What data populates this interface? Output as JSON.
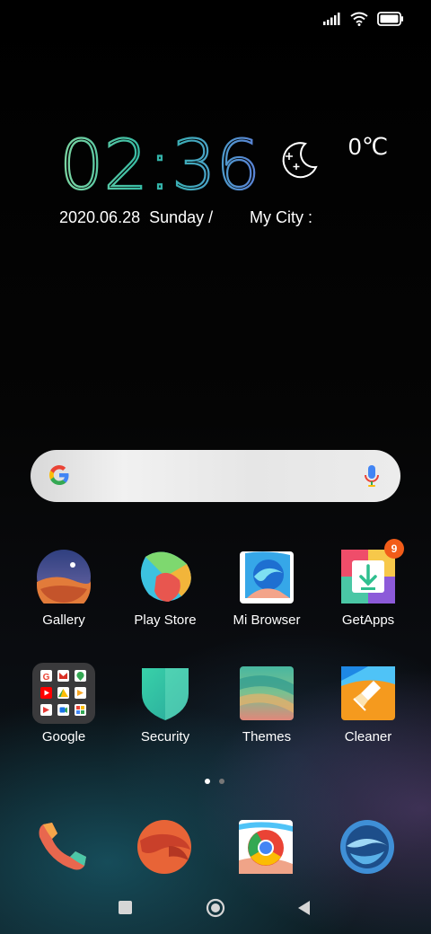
{
  "status_bar": {
    "signal_icon": "signal-icon",
    "wifi_icon": "wifi-icon",
    "battery_icon": "battery-icon"
  },
  "clock_widget": {
    "time": "02:36",
    "weather_icon": "moon-stars-icon",
    "temperature": "0℃",
    "date": "2020.06.28",
    "weekday": "Sunday /",
    "city": "My City :"
  },
  "search_bar": {
    "logo": "google-g-icon",
    "mic_icon": "mic-icon"
  },
  "apps": [
    {
      "label": "Gallery"
    },
    {
      "label": "Play Store"
    },
    {
      "label": "Mi Browser"
    },
    {
      "label": "GetApps",
      "badge": "9"
    },
    {
      "label": "Google"
    },
    {
      "label": "Security"
    },
    {
      "label": "Themes"
    },
    {
      "label": "Cleaner"
    }
  ],
  "page_indicator": {
    "pages": 2,
    "current": 1
  },
  "dock": [
    "phone-icon",
    "messaging-icon",
    "chrome-icon",
    "mi-browser-alt-icon"
  ],
  "nav_bar": [
    "recents-button",
    "home-button",
    "back-button"
  ],
  "colors": {
    "badge": "#f25c19",
    "search_bg": "#e8e8e8"
  }
}
